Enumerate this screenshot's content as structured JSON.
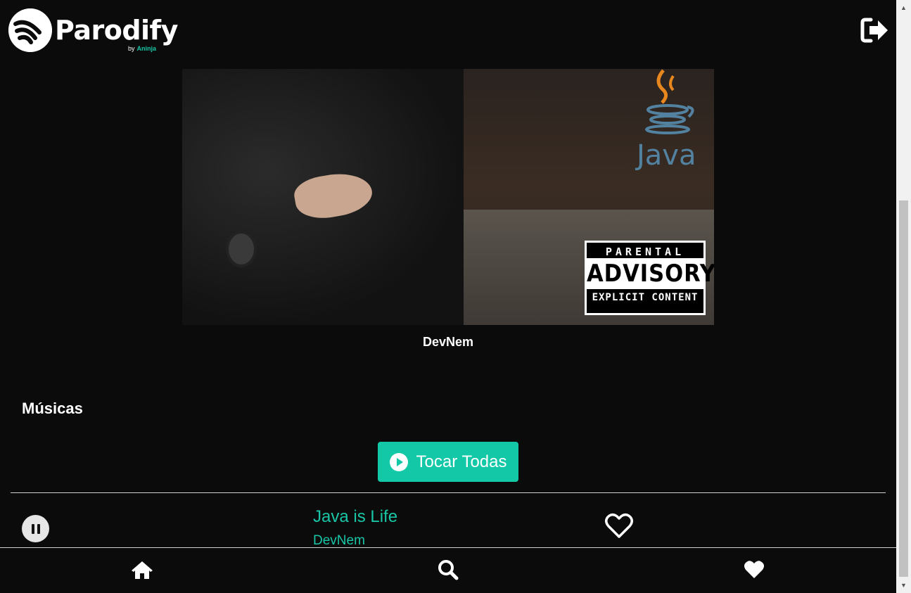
{
  "header": {
    "app_name": "Parodify",
    "by_label": "by",
    "by_brand": "Aninja",
    "logout_icon": "sign-out-icon"
  },
  "album": {
    "cover_texts": {
      "java_label": "Java",
      "advisory_top": "PARENTAL",
      "advisory_mid": "ADVISORY",
      "advisory_bottom": "EXPLICIT CONTENT"
    },
    "artist": "DevNem"
  },
  "section": {
    "title": "Músicas"
  },
  "play_all": {
    "label": "Tocar Todas",
    "icon": "play-circle-icon"
  },
  "tracks": [
    {
      "title": "Java is Life",
      "artist": "DevNem",
      "state_icon": "pause-icon",
      "favorite_icon": "heart-outline-icon"
    }
  ],
  "bottom_nav": {
    "items": [
      {
        "icon": "home-icon"
      },
      {
        "icon": "search-icon"
      },
      {
        "icon": "heart-icon"
      }
    ]
  },
  "colors": {
    "background": "#0b0b0b",
    "accent": "#12c8a6",
    "text": "#ffffff"
  }
}
